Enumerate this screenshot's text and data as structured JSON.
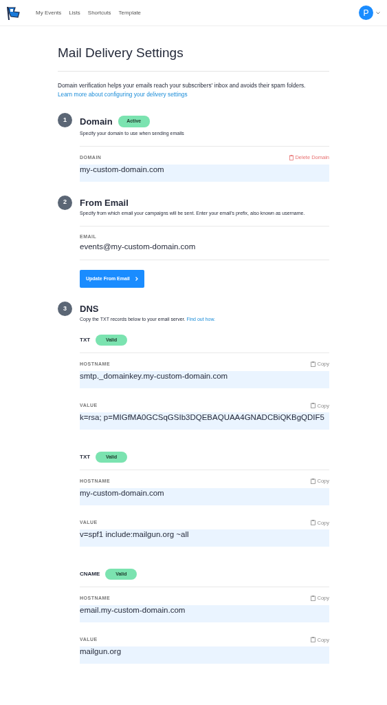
{
  "nav": {
    "links": [
      {
        "label": "My Events",
        "selected": false
      },
      {
        "label": "Lists",
        "selected": false
      },
      {
        "label": "Shortcuts",
        "selected": false
      },
      {
        "label": "Template",
        "selected": false
      }
    ],
    "avatar": "P"
  },
  "title": "Mail Delivery Settings",
  "intro": {
    "text": "Domain verification helps your emails reach your subscribers' inbox and avoids their spam folders.",
    "link": "Learn more about configuring your delivery settings"
  },
  "steps": [
    {
      "number": "1",
      "title": "Domain",
      "badge": "Active",
      "description": "Specify your domain to use when sending emails",
      "fields": [
        {
          "kind": "input",
          "label": "DOMAIN",
          "value": "my-custom-domain.com",
          "action": {
            "kind": "delete",
            "label": "Delete Domain"
          }
        }
      ]
    },
    {
      "number": "2",
      "title": "From Email",
      "description": "Specify from which email your campaigns will be sent. Enter your email's prefix, also known as username.",
      "fields": [
        {
          "kind": "text",
          "label": "EMAIL",
          "value": "events@my-custom-domain.com"
        }
      ],
      "button": "Update From Email"
    },
    {
      "number": "3",
      "title": "DNS",
      "description": "Copy the TXT records below to your email server.",
      "link": "Find out how.",
      "records": [
        {
          "type": "TXT",
          "badge": "Valid",
          "fields": [
            {
              "kind": "input",
              "label": "HOSTNAME",
              "value": "smtp._domainkey.my-custom-domain.com",
              "action": {
                "kind": "copy",
                "label": "Copy"
              }
            },
            {
              "kind": "input",
              "label": "VALUE",
              "value": "k=rsa; p=MIGfMA0GCSqGSIb3DQEBAQUAA4GNADCBiQKBgQDIF5",
              "action": {
                "kind": "copy",
                "label": "Copy"
              }
            }
          ]
        },
        {
          "type": "TXT",
          "badge": "Valid",
          "fields": [
            {
              "kind": "input",
              "label": "HOSTNAME",
              "value": "my-custom-domain.com",
              "action": {
                "kind": "copy",
                "label": "Copy"
              }
            },
            {
              "kind": "input",
              "label": "VALUE",
              "value": "v=spf1 include:mailgun.org ~all",
              "action": {
                "kind": "copy",
                "label": "Copy"
              }
            }
          ]
        },
        {
          "type": "CNAME",
          "badge": "Valid",
          "fields": [
            {
              "kind": "input",
              "label": "HOSTNAME",
              "value": "email.my-custom-domain.com",
              "action": {
                "kind": "copy",
                "label": "Copy"
              }
            },
            {
              "kind": "input",
              "label": "VALUE",
              "value": "mailgun.org",
              "action": {
                "kind": "copy",
                "label": "Copy"
              }
            }
          ]
        }
      ]
    }
  ]
}
